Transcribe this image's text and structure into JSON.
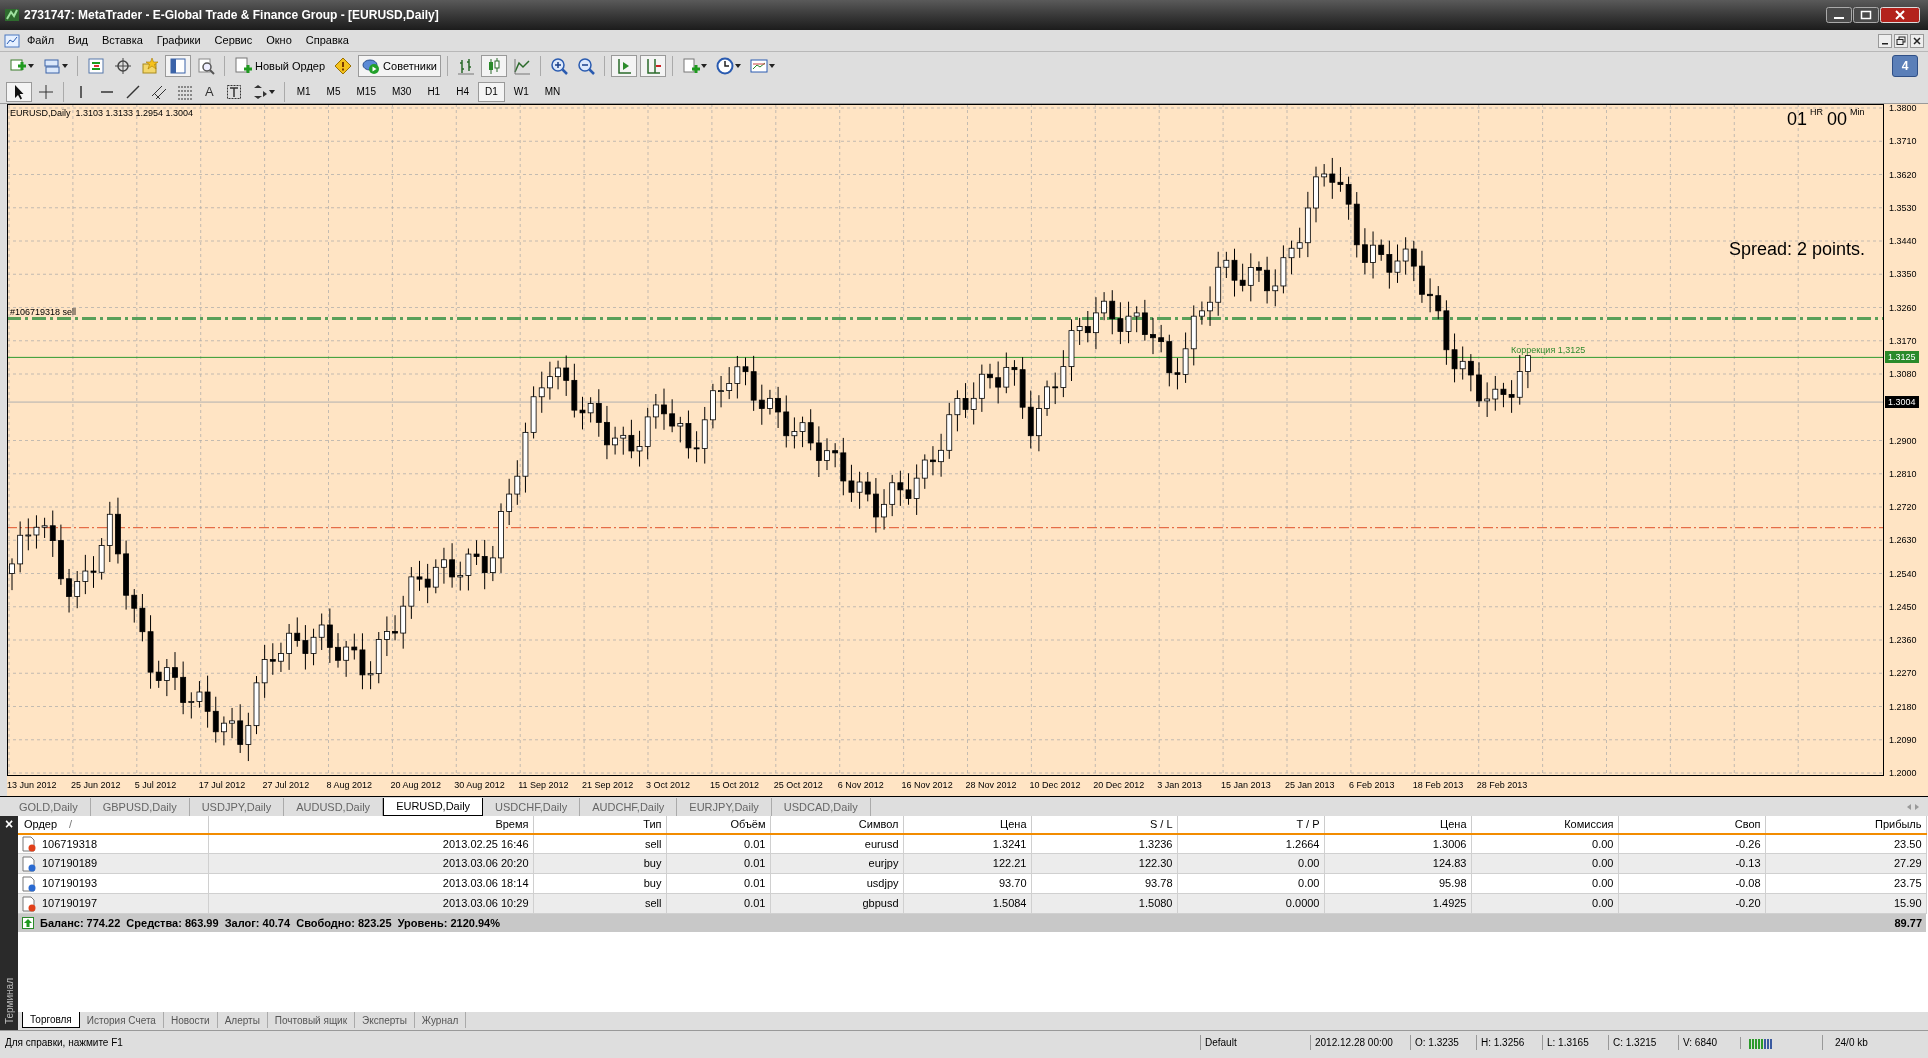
{
  "window": {
    "title": "2731747: MetaTrader - E-Global Trade & Finance Group - [EURUSD,Daily]"
  },
  "menu": [
    "Файл",
    "Вид",
    "Вставка",
    "Графики",
    "Сервис",
    "Окно",
    "Справка"
  ],
  "toolbar": {
    "new_order": "Новый Ордер",
    "experts": {
      "label": "Советники",
      "on": true
    },
    "notifications": "4"
  },
  "drawing_tools": {
    "text_tool": "A"
  },
  "timeframes": [
    {
      "label": "M1",
      "selected": false
    },
    {
      "label": "M5",
      "selected": false
    },
    {
      "label": "M15",
      "selected": false
    },
    {
      "label": "M30",
      "selected": false
    },
    {
      "label": "H1",
      "selected": false
    },
    {
      "label": "H4",
      "selected": false
    },
    {
      "label": "D1",
      "selected": true
    },
    {
      "label": "W1",
      "selected": false
    },
    {
      "label": "MN",
      "selected": false
    }
  ],
  "chart": {
    "header": "EURUSD,Daily  1.3103 1.3133 1.2954 1.3004",
    "timer": {
      "hours": "01",
      "hours_unit": "HR",
      "minutes": "00",
      "minutes_unit": "Min"
    },
    "spread": "Spread: 2 points.",
    "lines": [
      {
        "kind": "order",
        "label": "#106719318 sell"
      },
      {
        "kind": "correction",
        "label": "Коррекция 1,3125",
        "price_tag": "1.3125"
      },
      {
        "kind": "bid",
        "price_tag": "1.3004"
      },
      {
        "kind": "take_profit"
      }
    ],
    "price_ticks": [
      "1.3800",
      "1.3710",
      "1.3620",
      "1.3530",
      "1.3440",
      "1.3350",
      "1.3260",
      "1.3170",
      "1.3080",
      "1.2900",
      "1.2810",
      "1.2720",
      "1.2630",
      "1.2540",
      "1.2450",
      "1.2360",
      "1.2270",
      "1.2180",
      "1.2090",
      "1.2000"
    ],
    "date_labels": [
      "13 Jun 2012",
      "25 Jun 2012",
      "5 Jul 2012",
      "17 Jul 2012",
      "27 Jul 2012",
      "8 Aug 2012",
      "20 Aug 2012",
      "30 Aug 2012",
      "11 Sep 2012",
      "21 Sep 2012",
      "3 Oct 2012",
      "15 Oct 2012",
      "25 Oct 2012",
      "6 Nov 2012",
      "16 Nov 2012",
      "28 Nov 2012",
      "10 Dec 2012",
      "20 Dec 2012",
      "3 Jan 2013",
      "15 Jan 2013",
      "25 Jan 2013",
      "6 Feb 2013",
      "18 Feb 2013",
      "28 Feb 2013"
    ]
  },
  "chart_tabs": [
    {
      "label": "GOLD,Daily",
      "selected": false
    },
    {
      "label": "GBPUSD,Daily",
      "selected": false
    },
    {
      "label": "USDJPY,Daily",
      "selected": false
    },
    {
      "label": "AUDUSD,Daily",
      "selected": false
    },
    {
      "label": "EURUSD,Daily",
      "selected": true
    },
    {
      "label": "USDCHF,Daily",
      "selected": false
    },
    {
      "label": "AUDCHF,Daily",
      "selected": false
    },
    {
      "label": "EURJPY,Daily",
      "selected": false
    },
    {
      "label": "USDCAD,Daily",
      "selected": false
    }
  ],
  "terminal": {
    "title": "Терминал",
    "close": "×",
    "columns": [
      "Ордер",
      "Время",
      "Тип",
      "Объём",
      "Символ",
      "Цена",
      "S / L",
      "T / P",
      "Цена",
      "Комиссия",
      "Своп",
      "Прибыль"
    ],
    "sort_mark": "/",
    "rows": [
      {
        "kind": "sell",
        "cells": [
          "106719318",
          "2013.02.25 16:46",
          "sell",
          "0.01",
          "eurusd",
          "1.3241",
          "1.3236",
          "1.2664",
          "1.3006",
          "0.00",
          "-0.26",
          "23.50"
        ]
      },
      {
        "kind": "buy",
        "cells": [
          "107190189",
          "2013.03.06 20:20",
          "buy",
          "0.01",
          "eurjpy",
          "122.21",
          "122.30",
          "0.00",
          "124.83",
          "0.00",
          "-0.13",
          "27.29"
        ]
      },
      {
        "kind": "buy",
        "cells": [
          "107190193",
          "2013.03.06 18:14",
          "buy",
          "0.01",
          "usdjpy",
          "93.70",
          "93.78",
          "0.00",
          "95.98",
          "0.00",
          "-0.08",
          "23.75"
        ]
      },
      {
        "kind": "sell",
        "cells": [
          "107190197",
          "2013.03.06 10:29",
          "sell",
          "0.01",
          "gbpusd",
          "1.5084",
          "1.5080",
          "0.0000",
          "1.4925",
          "0.00",
          "-0.20",
          "15.90"
        ]
      }
    ],
    "summary": {
      "text": "Баланс: 774.22  Средства: 863.99  Залог: 40.74  Свободно: 823.25  Уровень: 2120.94%",
      "total": "89.77"
    },
    "tabs": [
      {
        "label": "Торговля",
        "selected": true
      },
      {
        "label": "История Счета",
        "selected": false
      },
      {
        "label": "Новости",
        "selected": false
      },
      {
        "label": "Алерты",
        "selected": false
      },
      {
        "label": "Почтовый ящик",
        "selected": false
      },
      {
        "label": "Эксперты",
        "selected": false
      },
      {
        "label": "Журнал",
        "selected": false
      }
    ]
  },
  "status_bar": {
    "help": "Для справки, нажмите F1",
    "profile": "Default",
    "fields": [
      "2012.12.28 00:00",
      "O: 1.3235",
      "H: 1.3256",
      "L: 1.3165",
      "C: 1.3215",
      "V: 6840"
    ],
    "traffic": "24/0 kb"
  }
}
